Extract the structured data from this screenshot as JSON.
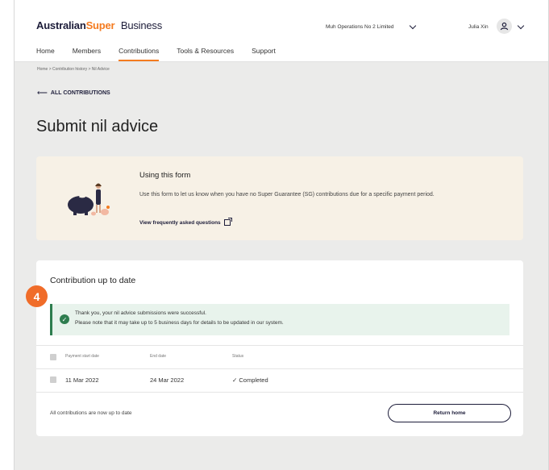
{
  "header": {
    "logo_prefix": "Australian",
    "logo_super": "Super",
    "logo_suffix": "Business",
    "org_name": "Muh Operations No 2 Limited",
    "user_name": "Julia Xin"
  },
  "nav": {
    "items": [
      "Home",
      "Members",
      "Contributions",
      "Tools & Resources",
      "Support"
    ],
    "active": "Contributions"
  },
  "breadcrumb": "Home >  Contribution history > Nil Advice",
  "back_label": "ALL CONTRIBUTIONS",
  "page_title": "Submit nil advice",
  "info": {
    "title": "Using this form",
    "body": "Use this form to let us know when you have no Super Guarantee (SG) contributions due for a specific payment period.",
    "link": "View frequently asked questions"
  },
  "card": {
    "title": "Contribution up to date",
    "step": "4",
    "success_line1": "Thank you, your nil advice submissions were successful.",
    "success_line2": "Please note that it may take up to 5 business days for details to be updated in our system.",
    "columns": [
      "Payment start date",
      "End date",
      "Status"
    ],
    "rows": [
      {
        "start": "11 Mar 2022",
        "end": "24 Mar 2022",
        "status": "✓ Completed"
      }
    ],
    "footer_text": "All contributions are now up to date",
    "return_button": "Return home"
  },
  "colors": {
    "accent": "#f47b20",
    "brand_navy": "#1d1d3a",
    "success": "#2e7d4f",
    "step_badge": "#f06c29"
  }
}
